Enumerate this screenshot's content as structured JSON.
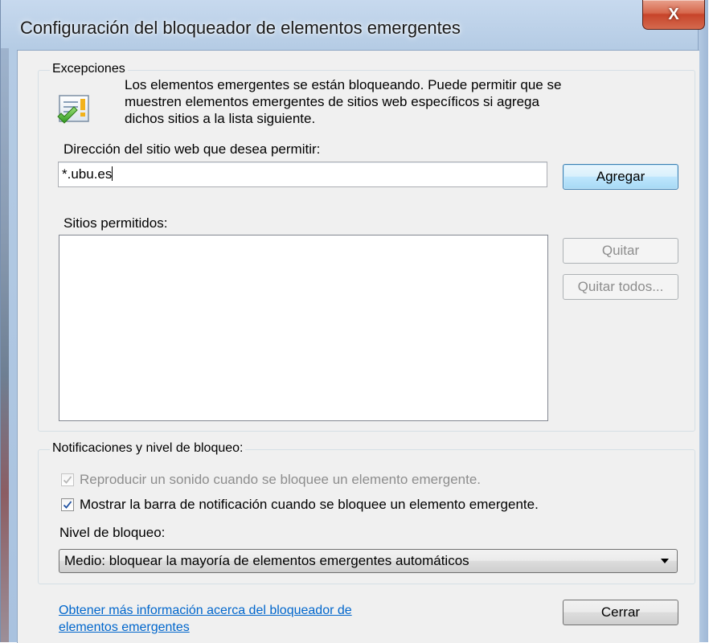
{
  "window": {
    "title": "Configuración del bloqueador de elementos emergentes",
    "close_glyph": "X"
  },
  "exceptions": {
    "legend": "Excepciones",
    "icon": "document-warning-check-icon",
    "description_lines": [
      "Los elementos emergentes se están bloqueando. Puede permitir que se",
      "muestren elementos emergentes de sitios web específicos si agrega",
      "dichos sitios a la lista siguiente."
    ],
    "address_label": "Dirección del sitio web que desea permitir:",
    "address_value": "*.ubu.es",
    "add_button": "Agregar",
    "allowed_label": "Sitios permitidos:",
    "allowed_sites": [],
    "remove_button": "Quitar",
    "remove_all_button": "Quitar todos..."
  },
  "notifications": {
    "legend": "Notificaciones y nivel de bloqueo:",
    "play_sound_label": "Reproducir un sonido cuando se bloquee un elemento emergente.",
    "play_sound_checked": true,
    "play_sound_enabled": false,
    "show_bar_label": "Mostrar la barra de notificación cuando se bloquee un elemento emergente.",
    "show_bar_checked": true,
    "level_label": "Nivel de bloqueo:",
    "level_value": "Medio: bloquear la mayoría de elementos emergentes automáticos"
  },
  "footer": {
    "help_link_line1": "Obtener más información acerca del bloqueador de",
    "help_link_line2": "elementos emergentes",
    "close_button": "Cerrar"
  },
  "colors": {
    "link": "#0066cc",
    "disabled_text": "#8d8d8d",
    "check_mark": "#1d4fa0"
  }
}
